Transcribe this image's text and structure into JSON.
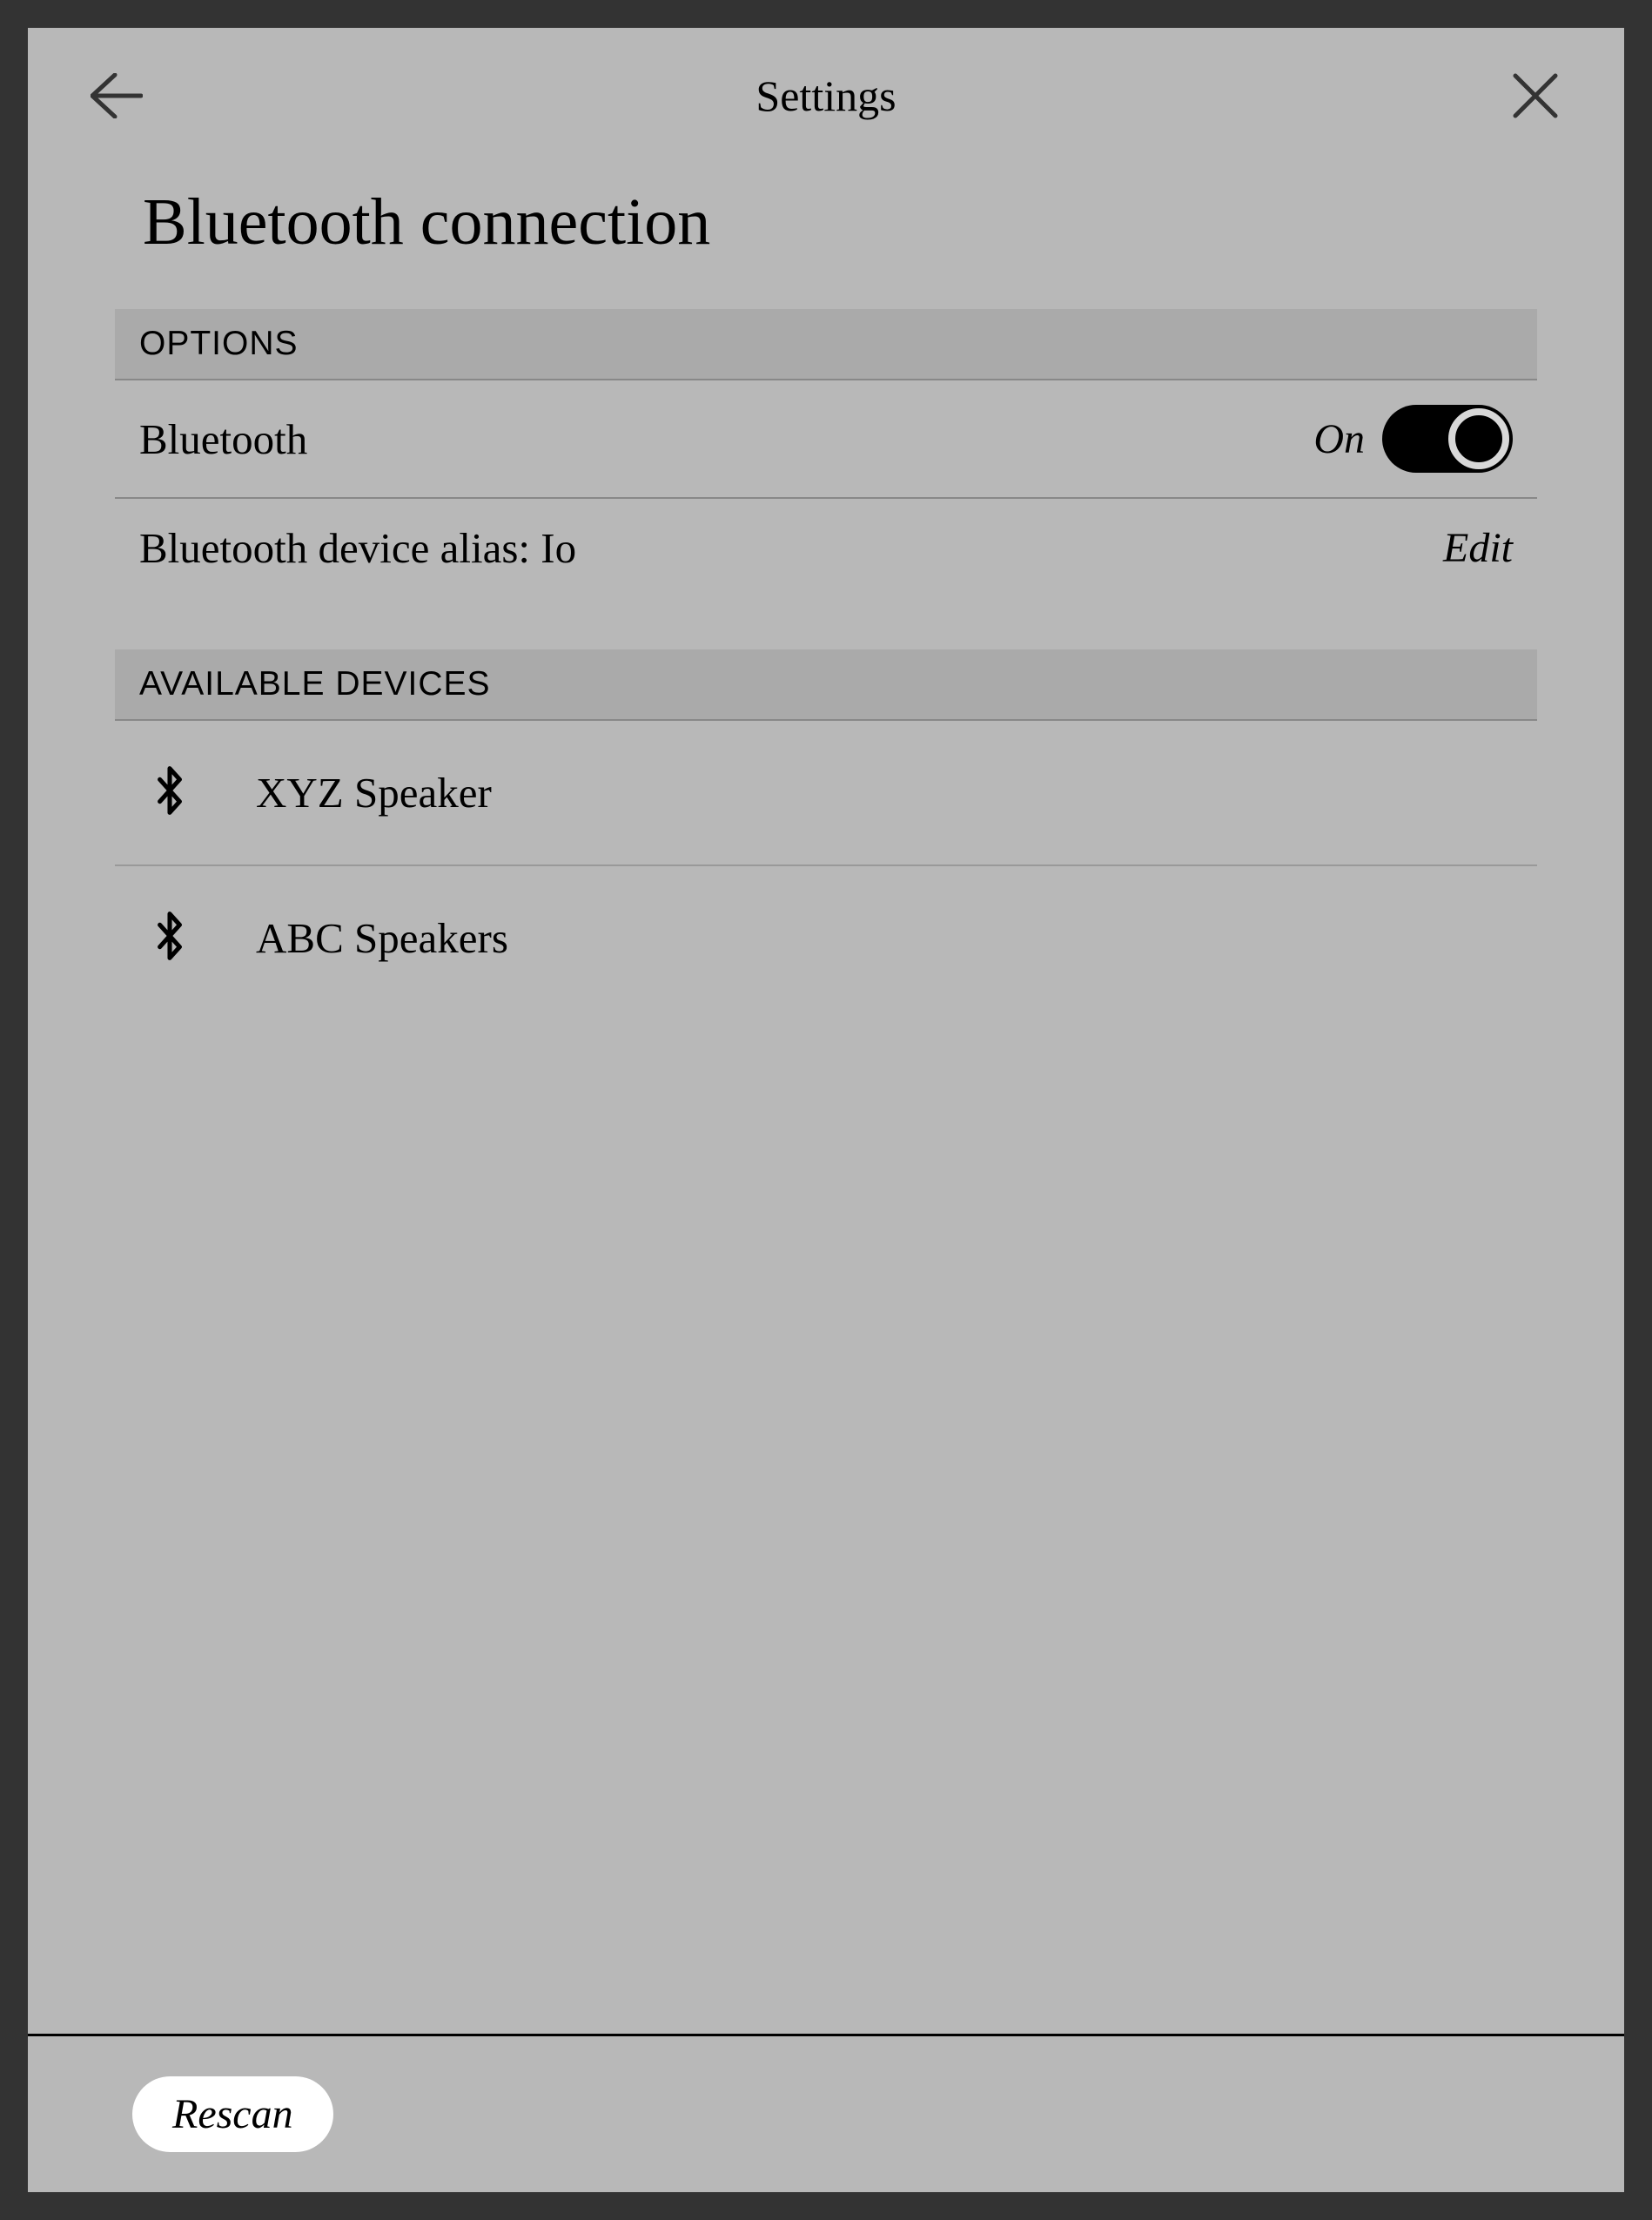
{
  "header": {
    "title": "Settings"
  },
  "page_title": "Bluetooth connection",
  "sections": {
    "options": {
      "header": "OPTIONS",
      "bluetooth": {
        "label": "Bluetooth",
        "state": "On"
      },
      "alias": {
        "label": "Bluetooth device alias: Io",
        "action": "Edit"
      }
    },
    "devices": {
      "header": "AVAILABLE DEVICES",
      "items": [
        {
          "name": "XYZ Speaker"
        },
        {
          "name": "ABC Speakers"
        }
      ]
    }
  },
  "footer": {
    "rescan": "Rescan"
  }
}
